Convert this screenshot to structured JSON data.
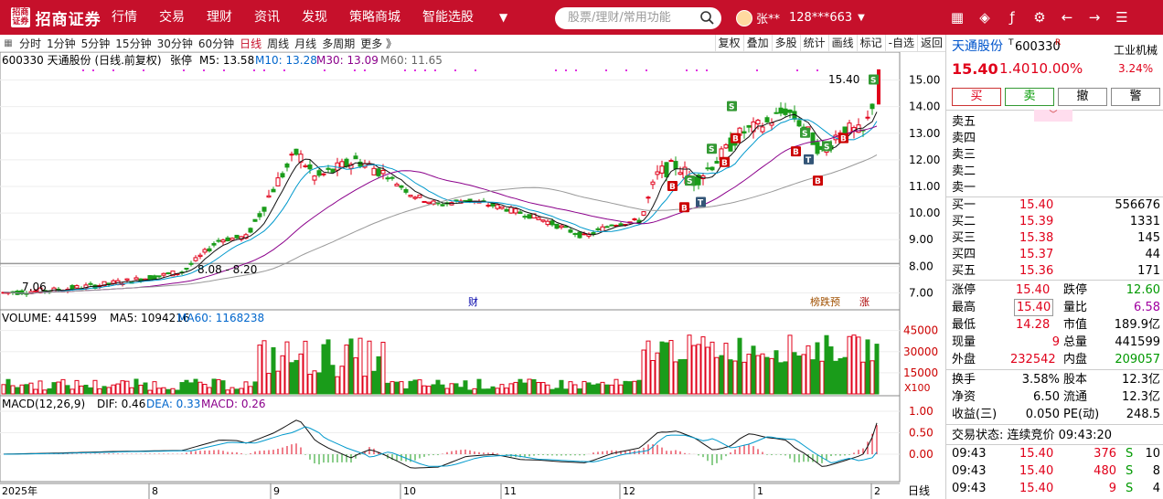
{
  "app": {
    "logo_seal": "招商证券",
    "logo_name": "招商证券"
  },
  "nav": [
    "行情",
    "交易",
    "理财",
    "资讯",
    "发现",
    "策略商城",
    "智能选股"
  ],
  "search": {
    "placeholder": "股票/理财/常用功能"
  },
  "user": {
    "name": "张**",
    "phone": "128***663"
  },
  "periods": [
    "分时",
    "1分钟",
    "5分钟",
    "15分钟",
    "30分钟",
    "60分钟",
    "日线",
    "周线",
    "月线",
    "多周期",
    "更多 》"
  ],
  "active_period": "日线",
  "tools": [
    "复权",
    "叠加",
    "多股",
    "统计",
    "画线",
    "标记",
    "-自选",
    "返回"
  ],
  "chart_labels": {
    "main_title": "600330 天通股份 (日线.前复权)",
    "limit_tag": "张停",
    "ma5": "M5: 13.58",
    "ma10": "M10: 13.28",
    "ma30": "M30: 13.09",
    "ma60": "M60: 11.65",
    "high_tag": "15.40",
    "range_tag": "8.08 - 8.20",
    "low_tag": "7.06",
    "fin_tag": "财",
    "event_tags": "榜跌预",
    "zhang_tag": "涨",
    "vol_title": "VOLUME: 441599",
    "vol_ma5": "MA5: 1094216",
    "vol_ma60": "MA60: 1168238",
    "x100": "X100",
    "macd_title": "MACD(12,26,9)",
    "dif": "DIF: 0.46",
    "dea": "DEA: 0.33",
    "macd": "MACD: 0.26",
    "year": "2025年",
    "daily": "日线",
    "buy_marker": "B",
    "sell_marker": "S",
    "t_marker": "T"
  },
  "chart_data": {
    "type": "candlestick",
    "price_ticks": [
      "15.00",
      "14.00",
      "13.00",
      "12.00",
      "11.00",
      "10.00",
      "9.00",
      "8.00",
      "7.00"
    ],
    "price_tick_values": [
      15,
      14,
      13,
      12,
      11,
      10,
      9,
      8,
      7
    ],
    "ylim": [
      6.5,
      15.5
    ],
    "reference_line": 8.1,
    "volume_ticks": [
      "45000",
      "30000",
      "15000"
    ],
    "volume_tick_values": [
      45000,
      30000,
      15000
    ],
    "macd_ticks": [
      "1.00",
      "0.50",
      "0.00"
    ],
    "macd_tick_values": [
      1,
      0.5,
      0
    ],
    "months": [
      "8",
      "9",
      "10",
      "11",
      "12",
      "1",
      "2"
    ],
    "last": {
      "close": 15.4,
      "open": 14.08,
      "high": 15.4,
      "low": 14.28,
      "volume": 441599
    }
  },
  "quote": {
    "name": "天通股份",
    "code": "600330",
    "badge_t": "T",
    "badge_r": "R",
    "industry": "工业机械",
    "industry_chg": "3.24%",
    "price": "15.40",
    "change": "1.40",
    "pct": "10.00%"
  },
  "trade_buttons": [
    "买",
    "卖",
    "撤",
    "警"
  ],
  "sell_levels": [
    "卖五",
    "卖四",
    "卖三",
    "卖二",
    "卖一"
  ],
  "buy_levels": [
    {
      "label": "买一",
      "price": "15.40",
      "vol": "556676"
    },
    {
      "label": "买二",
      "price": "15.39",
      "vol": "1331"
    },
    {
      "label": "买三",
      "price": "15.38",
      "vol": "145"
    },
    {
      "label": "买四",
      "price": "15.37",
      "vol": "44"
    },
    {
      "label": "买五",
      "price": "15.36",
      "vol": "171"
    }
  ],
  "stats": [
    {
      "l1": "涨停",
      "v1": "15.40",
      "c1": "red",
      "l2": "跌停",
      "v2": "12.60",
      "c2": "grn"
    },
    {
      "l1": "最高",
      "v1": "15.40",
      "c1": "red box",
      "l2": "量比",
      "v2": "6.58",
      "c2": "pur"
    },
    {
      "l1": "最低",
      "v1": "14.28",
      "c1": "red",
      "l2": "市值",
      "v2": "189.9亿",
      "c2": ""
    },
    {
      "l1": "现量",
      "v1": "9",
      "c1": "red",
      "l2": "总量",
      "v2": "441599",
      "c2": ""
    },
    {
      "l1": "外盘",
      "v1": "232542",
      "c1": "red",
      "l2": "内盘",
      "v2": "209057",
      "c2": "grn"
    }
  ],
  "stats2": [
    {
      "l1": "换手",
      "v1": "3.58%",
      "l2": "股本",
      "v2": "12.3亿"
    },
    {
      "l1": "净资",
      "v1": "6.50",
      "l2": "流通",
      "v2": "12.3亿"
    },
    {
      "l1": "收益(三)",
      "v1": "0.050",
      "l2": "PE(动)",
      "v2": "248.5"
    }
  ],
  "status": "交易状态: 连续竞价 09:43:20",
  "ticks": [
    {
      "time": "09:43",
      "price": "15.40",
      "vol": "376",
      "side": "S",
      "num": "10"
    },
    {
      "time": "09:43",
      "price": "15.40",
      "vol": "480",
      "side": "S",
      "num": "8"
    },
    {
      "time": "09:43",
      "price": "15.40",
      "vol": "9",
      "side": "S",
      "num": "4"
    }
  ]
}
